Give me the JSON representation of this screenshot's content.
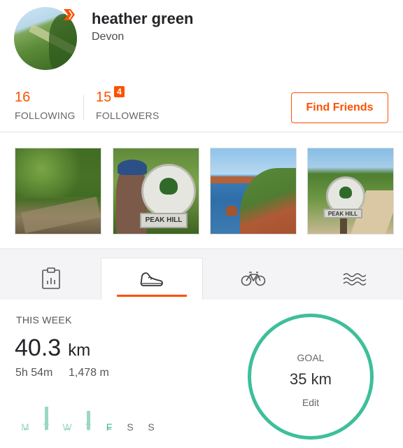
{
  "profile": {
    "name": "heather green",
    "location": "Devon"
  },
  "stats": {
    "following_count": "16",
    "following_label": "FOLLOWING",
    "followers_count": "15",
    "followers_label": "FOLLOWERS",
    "followers_notification": "4",
    "find_friends_label": "Find Friends"
  },
  "photos": [
    {
      "plaque_text": ""
    },
    {
      "plaque_text": "PEAK HILL"
    },
    {
      "plaque_text": ""
    },
    {
      "plaque_text": "PEAK HILL"
    }
  ],
  "tabs": [
    {
      "icon": "clipboard-chart-icon",
      "selected": false
    },
    {
      "icon": "running-shoe-icon",
      "selected": true
    },
    {
      "icon": "bicycle-icon",
      "selected": false
    },
    {
      "icon": "waves-swim-icon",
      "selected": false
    }
  ],
  "week": {
    "heading": "THIS WEEK",
    "distance_value": "40.3",
    "distance_unit": "km",
    "time": "5h 54m",
    "elevation": "1,478 m",
    "days": [
      {
        "label": "M",
        "level": 0.0,
        "state": "done"
      },
      {
        "label": "T",
        "level": 0.55,
        "state": "done"
      },
      {
        "label": "W",
        "level": 0.0,
        "state": "done"
      },
      {
        "label": "T",
        "level": 0.45,
        "state": "done"
      },
      {
        "label": "F",
        "level": 0.0,
        "state": "today"
      },
      {
        "label": "S",
        "level": null,
        "state": "future"
      },
      {
        "label": "S",
        "level": null,
        "state": "future"
      }
    ],
    "goal": {
      "label": "GOAL",
      "value": "35 km",
      "edit_label": "Edit"
    }
  },
  "colors": {
    "accent": "#fc5200",
    "goal_ring": "#3dbf9a",
    "bar": "#9ad8c2"
  }
}
